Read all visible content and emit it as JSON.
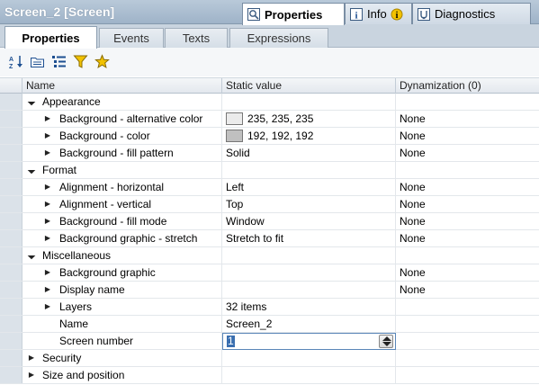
{
  "window": {
    "title": "Screen_2 [Screen]"
  },
  "panel_tabs": [
    {
      "label": "Properties",
      "icon": "properties-icon",
      "active": true
    },
    {
      "label": "Info",
      "icon": "info-icon",
      "badge_icon": "info-badge-icon"
    },
    {
      "label": "Diagnostics",
      "icon": "diagnostics-icon"
    }
  ],
  "sub_tabs": [
    {
      "label": "Properties",
      "active": true
    },
    {
      "label": "Events"
    },
    {
      "label": "Texts"
    },
    {
      "label": "Expressions"
    }
  ],
  "toolbar": {
    "buttons": [
      "sort-az-icon",
      "group-folder-icon",
      "list-view-icon",
      "filter-icon",
      "favorites-star-icon"
    ]
  },
  "grid": {
    "columns": {
      "name": "Name",
      "static_value": "Static value",
      "dynamization": "Dynamization (0)"
    },
    "rows": [
      {
        "level": 0,
        "name": "Appearance",
        "expanded": true,
        "group": true,
        "value": "",
        "dyn": ""
      },
      {
        "level": 1,
        "name": "Background - alternative color",
        "expandable": true,
        "value": "235, 235, 235",
        "swatch": "#ebebeb",
        "dyn": "None"
      },
      {
        "level": 1,
        "name": "Background - color",
        "expandable": true,
        "value": "192, 192, 192",
        "swatch": "#c0c0c0",
        "dyn": "None"
      },
      {
        "level": 1,
        "name": "Background - fill pattern",
        "expandable": true,
        "value": "Solid",
        "dyn": "None"
      },
      {
        "level": 0,
        "name": "Format",
        "expanded": true,
        "group": true,
        "value": "",
        "dyn": ""
      },
      {
        "level": 1,
        "name": "Alignment - horizontal",
        "expandable": true,
        "value": "Left",
        "dyn": "None"
      },
      {
        "level": 1,
        "name": "Alignment - vertical",
        "expandable": true,
        "value": "Top",
        "dyn": "None"
      },
      {
        "level": 1,
        "name": "Background - fill mode",
        "expandable": true,
        "value": "Window",
        "dyn": "None"
      },
      {
        "level": 1,
        "name": "Background graphic - stretch",
        "expandable": true,
        "value": "Stretch to fit",
        "dyn": "None"
      },
      {
        "level": 0,
        "name": "Miscellaneous",
        "expanded": true,
        "group": true,
        "value": "",
        "dyn": ""
      },
      {
        "level": 1,
        "name": "Background graphic",
        "expandable": true,
        "value": "",
        "dyn": "None"
      },
      {
        "level": 1,
        "name": "Display name",
        "expandable": true,
        "value": "",
        "dyn": "None"
      },
      {
        "level": 1,
        "name": "Layers",
        "expandable": true,
        "value": "32 items",
        "dyn": ""
      },
      {
        "level": 1,
        "name": "Name",
        "expandable": false,
        "value": "Screen_2",
        "dyn": ""
      },
      {
        "level": 1,
        "name": "Screen number",
        "expandable": false,
        "value": "1",
        "editing": true,
        "dyn": ""
      },
      {
        "level": 0,
        "name": "Security",
        "expanded": false,
        "group": true,
        "value": "",
        "dyn": ""
      },
      {
        "level": 0,
        "name": "Size and position",
        "expanded": false,
        "group": true,
        "value": "",
        "dyn": ""
      }
    ]
  }
}
